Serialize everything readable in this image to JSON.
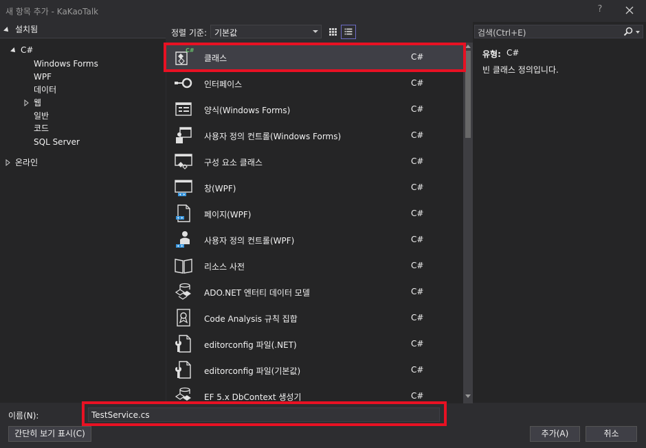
{
  "window": {
    "title": "새 항목 추가 - KaKaoTalk",
    "help": "?"
  },
  "left": {
    "installed": "설치됨",
    "csharp": "C#",
    "children": [
      "Windows Forms",
      "WPF",
      "데이터",
      "웹",
      "일반",
      "코드",
      "SQL Server"
    ],
    "online": "온라인"
  },
  "toolbar": {
    "sort_label": "정렬 기준:",
    "sort_value": "기본값"
  },
  "items": [
    {
      "label": "클래스",
      "lang": "C#",
      "icon": "class-icon"
    },
    {
      "label": "인터페이스",
      "lang": "C#",
      "icon": "interface-icon"
    },
    {
      "label": "양식(Windows Forms)",
      "lang": "C#",
      "icon": "form-icon"
    },
    {
      "label": "사용자 정의 컨트롤(Windows Forms)",
      "lang": "C#",
      "icon": "user-control-icon"
    },
    {
      "label": "구성 요소 클래스",
      "lang": "C#",
      "icon": "component-class-icon"
    },
    {
      "label": "창(WPF)",
      "lang": "C#",
      "icon": "wpf-window-icon"
    },
    {
      "label": "페이지(WPF)",
      "lang": "C#",
      "icon": "wpf-page-icon"
    },
    {
      "label": "사용자 정의 컨트롤(WPF)",
      "lang": "C#",
      "icon": "wpf-user-control-icon"
    },
    {
      "label": "리소스 사전",
      "lang": "C#",
      "icon": "resource-dictionary-icon"
    },
    {
      "label": "ADO.NET 엔터티 데이터 모델",
      "lang": "C#",
      "icon": "entity-data-model-icon"
    },
    {
      "label": "Code Analysis 규칙 집합",
      "lang": "C#",
      "icon": "ruleset-icon"
    },
    {
      "label": "editorconfig 파일(.NET)",
      "lang": "C#",
      "icon": "editorconfig-icon"
    },
    {
      "label": "editorconfig 파일(기본값)",
      "lang": "C#",
      "icon": "editorconfig-icon"
    },
    {
      "label": "EF 5.x DbContext 생성기",
      "lang": "C#",
      "icon": "dbcontext-generator-icon"
    }
  ],
  "right": {
    "search_placeholder": "검색(Ctrl+E)",
    "type_label": "유형:",
    "type_value": "C#",
    "description": "빈 클래스 정의입니다."
  },
  "bottom": {
    "name_label": "이름(N):",
    "name_value": "TestService.cs",
    "compact_button": "간단히 보기 표시(C)",
    "add_button": "추가(A)",
    "cancel_button": "취소"
  },
  "colors": {
    "background": "#2d2d30",
    "pane": "#252526",
    "selection": "#3f3f46",
    "highlight": "#e81123",
    "accent_blue": "#3a96dd",
    "csharp_green": "#68c06c"
  }
}
